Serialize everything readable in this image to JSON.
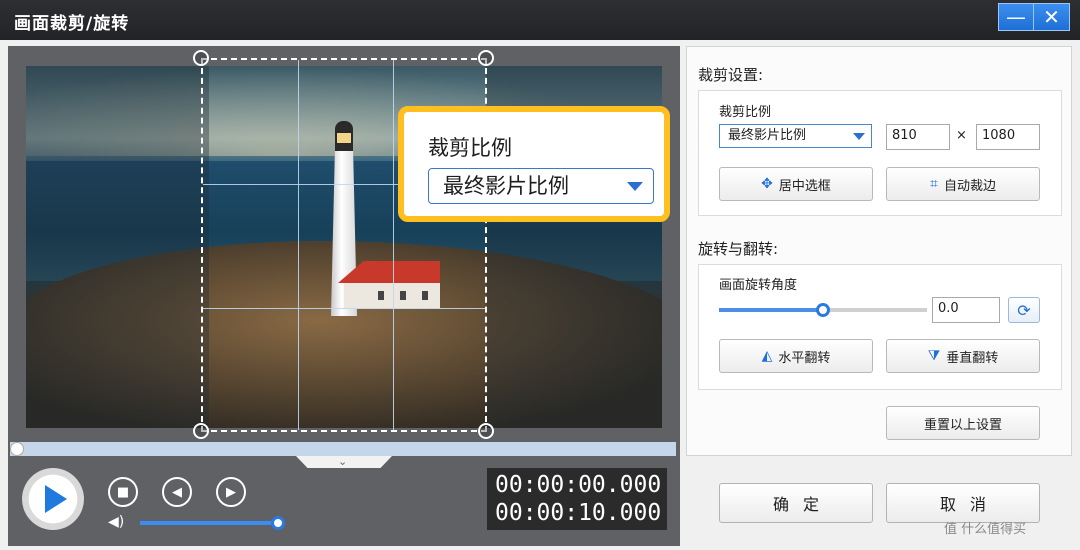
{
  "window": {
    "title": "画面裁剪/旋转",
    "minimize_glyph": "—",
    "close_glyph": "✕"
  },
  "callout": {
    "label": "裁剪比例",
    "selected": "最终影片比例"
  },
  "player": {
    "play_icon": "play-icon",
    "time_current": "00:00:00.000",
    "time_total": "00:00:10.000",
    "volume": 0.97,
    "progress": 0.0
  },
  "crop_settings": {
    "section_title": "裁剪设置:",
    "ratio_label": "裁剪比例",
    "ratio_value": "最终影片比例",
    "width": "810",
    "times": "×",
    "height": "1080",
    "center_button": "居中选框",
    "auto_trim_button": "自动裁边"
  },
  "rotate_settings": {
    "section_title": "旋转与翻转:",
    "angle_label": "画面旋转角度",
    "angle_value": "0.0",
    "angle_slider": 0.5,
    "flip_h_button": "水平翻转",
    "flip_v_button": "垂直翻转"
  },
  "reset_button": "重置以上设置",
  "ok_button": "确定",
  "cancel_button": "取消",
  "watermark": "值 什么值得买",
  "colors": {
    "accent": "#1f7ae0",
    "callout": "#ffbf1f",
    "titlebar": "#2a2b2f"
  }
}
